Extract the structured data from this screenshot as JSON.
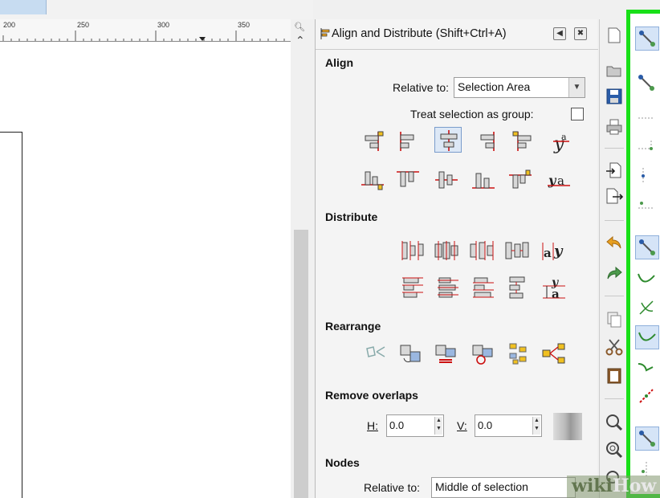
{
  "ruler": {
    "ticks": [
      "200",
      "250",
      "300",
      "350"
    ]
  },
  "dialog": {
    "title": "Align and Distribute (Shift+Ctrl+A)",
    "align_section": "Align",
    "relative_to_label": "Relative to:",
    "relative_to_value": "Selection Area",
    "treat_group_label": "Treat selection as group:",
    "distribute_section": "Distribute",
    "rearrange_section": "Rearrange",
    "remove_overlaps_section": "Remove overlaps",
    "h_label": "H:",
    "h_value": "0.0",
    "v_label": "V:",
    "v_value": "0.0",
    "nodes_section": "Nodes",
    "nodes_relative_label": "Relative to:",
    "nodes_relative_value": "Middle of selection"
  },
  "watermark": {
    "brand_a": "wiki",
    "brand_b": "How"
  },
  "colors": {
    "snap_highlight": "#18e018",
    "guide_red": "#cc1111",
    "selection_bg": "#dde8f6"
  }
}
